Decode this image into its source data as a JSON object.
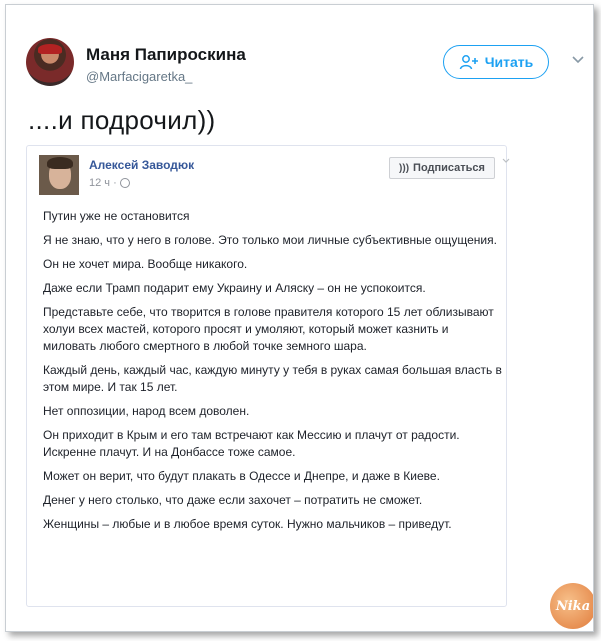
{
  "tweet": {
    "author_name": "Маня Папироскина",
    "author_handle": "@Marfacigaretka_",
    "follow_label": "Читать",
    "text": "....и подрочил))"
  },
  "embed": {
    "author_name": "Алексей Заводюк",
    "time": "12 ч ·",
    "subscribe_label": "Подписаться",
    "paragraphs": [
      "Путин уже не остановится",
      "Я не знаю, что у него в голове. Это только мои личные субъективные ощущения.",
      "Он не хочет мира. Вообще никакого.",
      "Даже если Трамп подарит ему Украину и Аляску – он не успокоится.",
      "Представьте себе, что творится в голове правителя которого 15 лет облизывают холуи всех мастей, которого просят и умоляют, который может казнить и миловать любого смертного в любой точке земного шара.",
      "Каждый день, каждый час, каждую минуту у тебя в руках самая большая власть в этом мире. И так 15 лет.",
      "Нет оппозиции, народ всем доволен.",
      "Он приходит в Крым и его там встречают как Мессию и плачут от радости. Искренне плачут. И на Донбассе тоже самое.",
      "Может он верит, что будут плакать в Одессе и Днепре, и даже в Киеве.",
      "Денег у него столько, что даже если захочет – потратить не сможет.",
      "Женщины – любые и в любое время суток. Нужно мальчиков – приведут."
    ]
  },
  "watermark": "Nika",
  "colors": {
    "twitter_blue": "#1da1f2",
    "facebook_link": "#365899",
    "muted": "#657786"
  }
}
